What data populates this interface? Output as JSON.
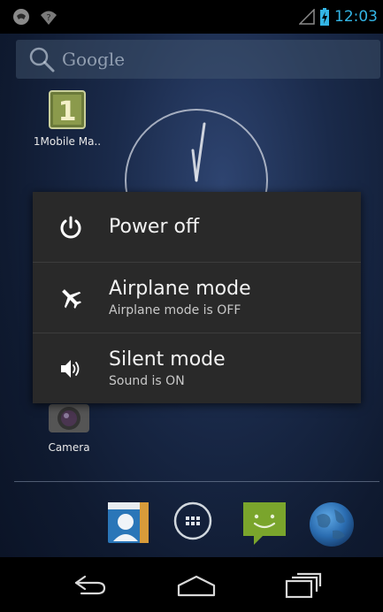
{
  "status_bar": {
    "time": "12:03",
    "icons": [
      "notification-icon",
      "wifi-unknown-icon",
      "signal-icon",
      "battery-charging-icon"
    ],
    "accent_color": "#33b5e5"
  },
  "search": {
    "placeholder": "Google",
    "icon": "search-icon"
  },
  "desktop": {
    "apps": [
      {
        "label": "1Mobile Ma..",
        "icon": "1mobile-market-icon",
        "glyph": "1"
      },
      {
        "label": "Camera",
        "icon": "camera-icon"
      }
    ],
    "widget": "analog-clock-widget"
  },
  "power_dialog": {
    "items": [
      {
        "title": "Power off",
        "subtitle": "",
        "icon": "power-icon"
      },
      {
        "title": "Airplane mode",
        "subtitle": "Airplane mode is OFF",
        "icon": "airplane-icon"
      },
      {
        "title": "Silent mode",
        "subtitle": "Sound is ON",
        "icon": "speaker-icon"
      }
    ]
  },
  "dock": {
    "icons": [
      "contacts-icon",
      "all-apps-icon",
      "messaging-icon",
      "browser-icon"
    ]
  },
  "nav_bar": {
    "buttons": [
      "back-icon",
      "home-icon",
      "recent-apps-icon"
    ]
  }
}
